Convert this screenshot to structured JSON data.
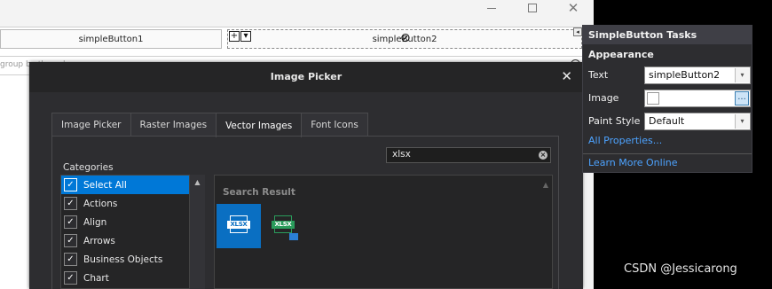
{
  "designer": {
    "buttons": [
      {
        "label": "simpleButton1"
      },
      {
        "label": "simpleButton2"
      }
    ],
    "smart_tag_glyphs": [
      "+",
      "▾"
    ],
    "group_text": "group by the column",
    "tasks_arrow_glyph": "◂"
  },
  "picker": {
    "title": "Image Picker",
    "close_glyph": "✕",
    "tabs": [
      {
        "label": "Image Picker"
      },
      {
        "label": "Raster Images"
      },
      {
        "label": "Vector Images"
      },
      {
        "label": "Font Icons"
      }
    ],
    "active_tab": "Vector Images",
    "search": {
      "value": "xlsx",
      "clear_glyph": "×"
    },
    "categories_label": "Categories",
    "categories": [
      {
        "label": "Select All",
        "checked": true,
        "selected": true
      },
      {
        "label": "Actions",
        "checked": true
      },
      {
        "label": "Align",
        "checked": true
      },
      {
        "label": "Arrows",
        "checked": true
      },
      {
        "label": "Business Objects",
        "checked": true
      },
      {
        "label": "Chart",
        "checked": true
      }
    ],
    "check_glyph": "✓",
    "scroll_up_glyph": "▲",
    "results_header": "Search Result",
    "results": [
      {
        "icon": "xlsx-icon",
        "text": "XLSX",
        "selected": true
      },
      {
        "icon": "xlsx-mail-icon",
        "text": "XLSX",
        "selected": false
      }
    ]
  },
  "tasks": {
    "title": "SimpleButton Tasks",
    "section": "Appearance",
    "text_label": "Text",
    "text_value": "simpleButton2",
    "image_label": "Image",
    "paint_style_label": "Paint Style",
    "paint_style_value": "Default",
    "dropdown_glyph": "▾",
    "ellipsis_glyph": "...",
    "all_properties_link": "All Properties...",
    "learn_more_link": "Learn More Online"
  },
  "watermark": "CSDN @Jessicarong",
  "colors": {
    "accent": "#0078d7",
    "dialog_bg": "#2d2d30",
    "link": "#4da3ff",
    "xlsx_green": "#2a9c5b"
  }
}
